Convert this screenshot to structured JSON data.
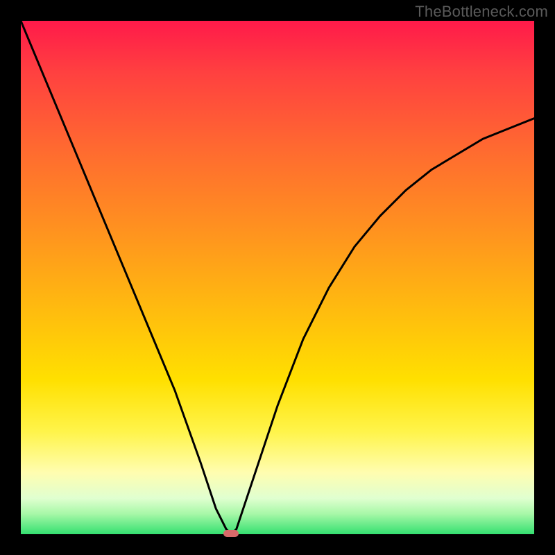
{
  "watermark": "TheBottleneck.com",
  "chart_data": {
    "type": "line",
    "title": "",
    "xlabel": "",
    "ylabel": "",
    "xlim": [
      0,
      100
    ],
    "ylim": [
      0,
      100
    ],
    "grid": false,
    "series": [
      {
        "name": "curve",
        "x": [
          0,
          5,
          10,
          15,
          20,
          25,
          30,
          35,
          38,
          40,
          41,
          42,
          45,
          50,
          55,
          60,
          65,
          70,
          75,
          80,
          85,
          90,
          95,
          100
        ],
        "values": [
          100,
          88,
          76,
          64,
          52,
          40,
          28,
          14,
          5,
          1,
          0,
          1,
          10,
          25,
          38,
          48,
          56,
          62,
          67,
          71,
          74,
          77,
          79,
          81
        ]
      }
    ],
    "annotations": [
      {
        "name": "min-marker",
        "x": 41,
        "y": 0
      }
    ]
  },
  "colors": {
    "curve_stroke": "#000000",
    "marker_fill": "#d86a6a"
  }
}
